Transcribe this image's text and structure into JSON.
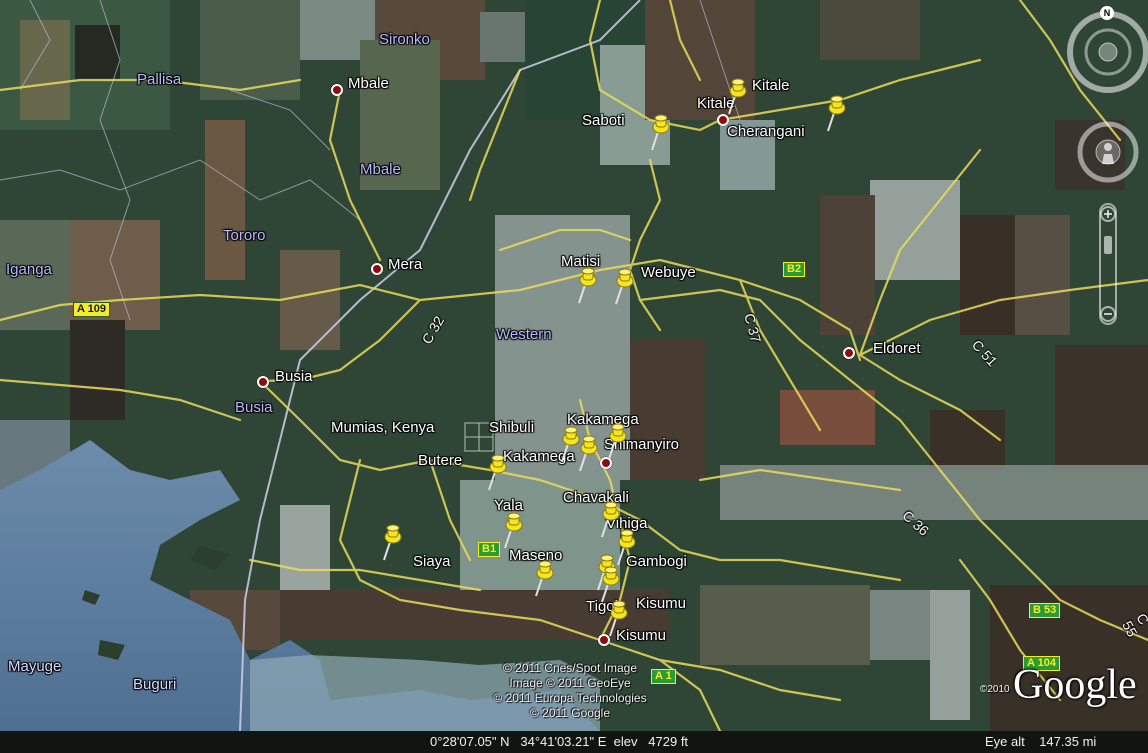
{
  "map": {
    "place_labels": [
      {
        "id": "sironko",
        "text": "Sironko",
        "kind": "region"
      },
      {
        "id": "pallisa",
        "text": "Pallisa",
        "kind": "region"
      },
      {
        "id": "mbale-city",
        "text": "Mbale",
        "kind": "city"
      },
      {
        "id": "mbale-region",
        "text": "Mbale",
        "kind": "region"
      },
      {
        "id": "tororo",
        "text": "Tororo",
        "kind": "region"
      },
      {
        "id": "iganga",
        "text": "Iganga",
        "kind": "region"
      },
      {
        "id": "mera",
        "text": "Mera",
        "kind": "city"
      },
      {
        "id": "busia-city",
        "text": "Busia",
        "kind": "city"
      },
      {
        "id": "busia-region",
        "text": "Busia",
        "kind": "region"
      },
      {
        "id": "western",
        "text": "Western",
        "kind": "region"
      },
      {
        "id": "eldoret",
        "text": "Eldoret",
        "kind": "city"
      },
      {
        "id": "cherangani-city",
        "text": "Cherangani",
        "kind": "city"
      },
      {
        "id": "kisumu-city",
        "text": "Kisumu",
        "kind": "city"
      },
      {
        "id": "shimanyiro",
        "text": "Shimanyiro",
        "kind": "city"
      },
      {
        "id": "mayuge",
        "text": "Mayuge",
        "kind": "water"
      },
      {
        "id": "buguri",
        "text": "Buguri",
        "kind": "water"
      }
    ],
    "pin_labels": [
      {
        "id": "kitale",
        "text": "Kitale"
      },
      {
        "id": "kitale-2",
        "text": "Kitale"
      },
      {
        "id": "saboti",
        "text": "Saboti"
      },
      {
        "id": "matisi",
        "text": "Matisi"
      },
      {
        "id": "webuye",
        "text": "Webuye"
      },
      {
        "id": "mumias",
        "text": "Mumias, Kenya"
      },
      {
        "id": "shibuli",
        "text": "Shibuli"
      },
      {
        "id": "kakamega-1",
        "text": "Kakamega"
      },
      {
        "id": "kakamega-2",
        "text": "Kakamega"
      },
      {
        "id": "butere",
        "text": "Butere"
      },
      {
        "id": "yala",
        "text": "Yala"
      },
      {
        "id": "chavakali",
        "text": "Chavakali"
      },
      {
        "id": "vihiga",
        "text": "Vihiga"
      },
      {
        "id": "siaya",
        "text": "Siaya"
      },
      {
        "id": "maseno",
        "text": "Maseno"
      },
      {
        "id": "gambogi",
        "text": "Gambogi"
      },
      {
        "id": "tigoi",
        "text": "Tigoi"
      },
      {
        "id": "kisumu-pin",
        "text": "Kisumu"
      }
    ],
    "road_shields": [
      {
        "id": "a109",
        "text": "A 109",
        "style": "yellow"
      },
      {
        "id": "b2",
        "text": "B2",
        "style": "green"
      },
      {
        "id": "b1",
        "text": "B1",
        "style": "green"
      },
      {
        "id": "a1",
        "text": "A 1",
        "style": "green"
      },
      {
        "id": "b53",
        "text": "B 53",
        "style": "green"
      },
      {
        "id": "a104",
        "text": "A 104",
        "style": "green"
      }
    ],
    "road_numbers": [
      {
        "id": "c32",
        "text": "C 32"
      },
      {
        "id": "c37",
        "text": "C 37"
      },
      {
        "id": "c51",
        "text": "C 51"
      },
      {
        "id": "c36",
        "text": "C 36"
      },
      {
        "id": "c55",
        "text": "C 55"
      }
    ],
    "credits": [
      "© 2011 Cnes/Spot Image",
      "Image © 2011 GeoEye",
      "© 2011 Europa Technologies",
      "© 2011 Google"
    ],
    "logo_text": "Google",
    "copyright_year": "©2010"
  },
  "status_bar": {
    "coordinates": "0°28'07.05\" N   34°41'03.21\" E  elev   4729 ft",
    "eye_alt": "Eye alt    147.35 mi"
  },
  "nav": {
    "north_label": "N"
  },
  "colors": {
    "road": "#e8dc5a",
    "border": "#c9c9d9",
    "pin": "#f5e51f",
    "city_dot": "#8b0d12",
    "water": "#5f7fa3"
  }
}
